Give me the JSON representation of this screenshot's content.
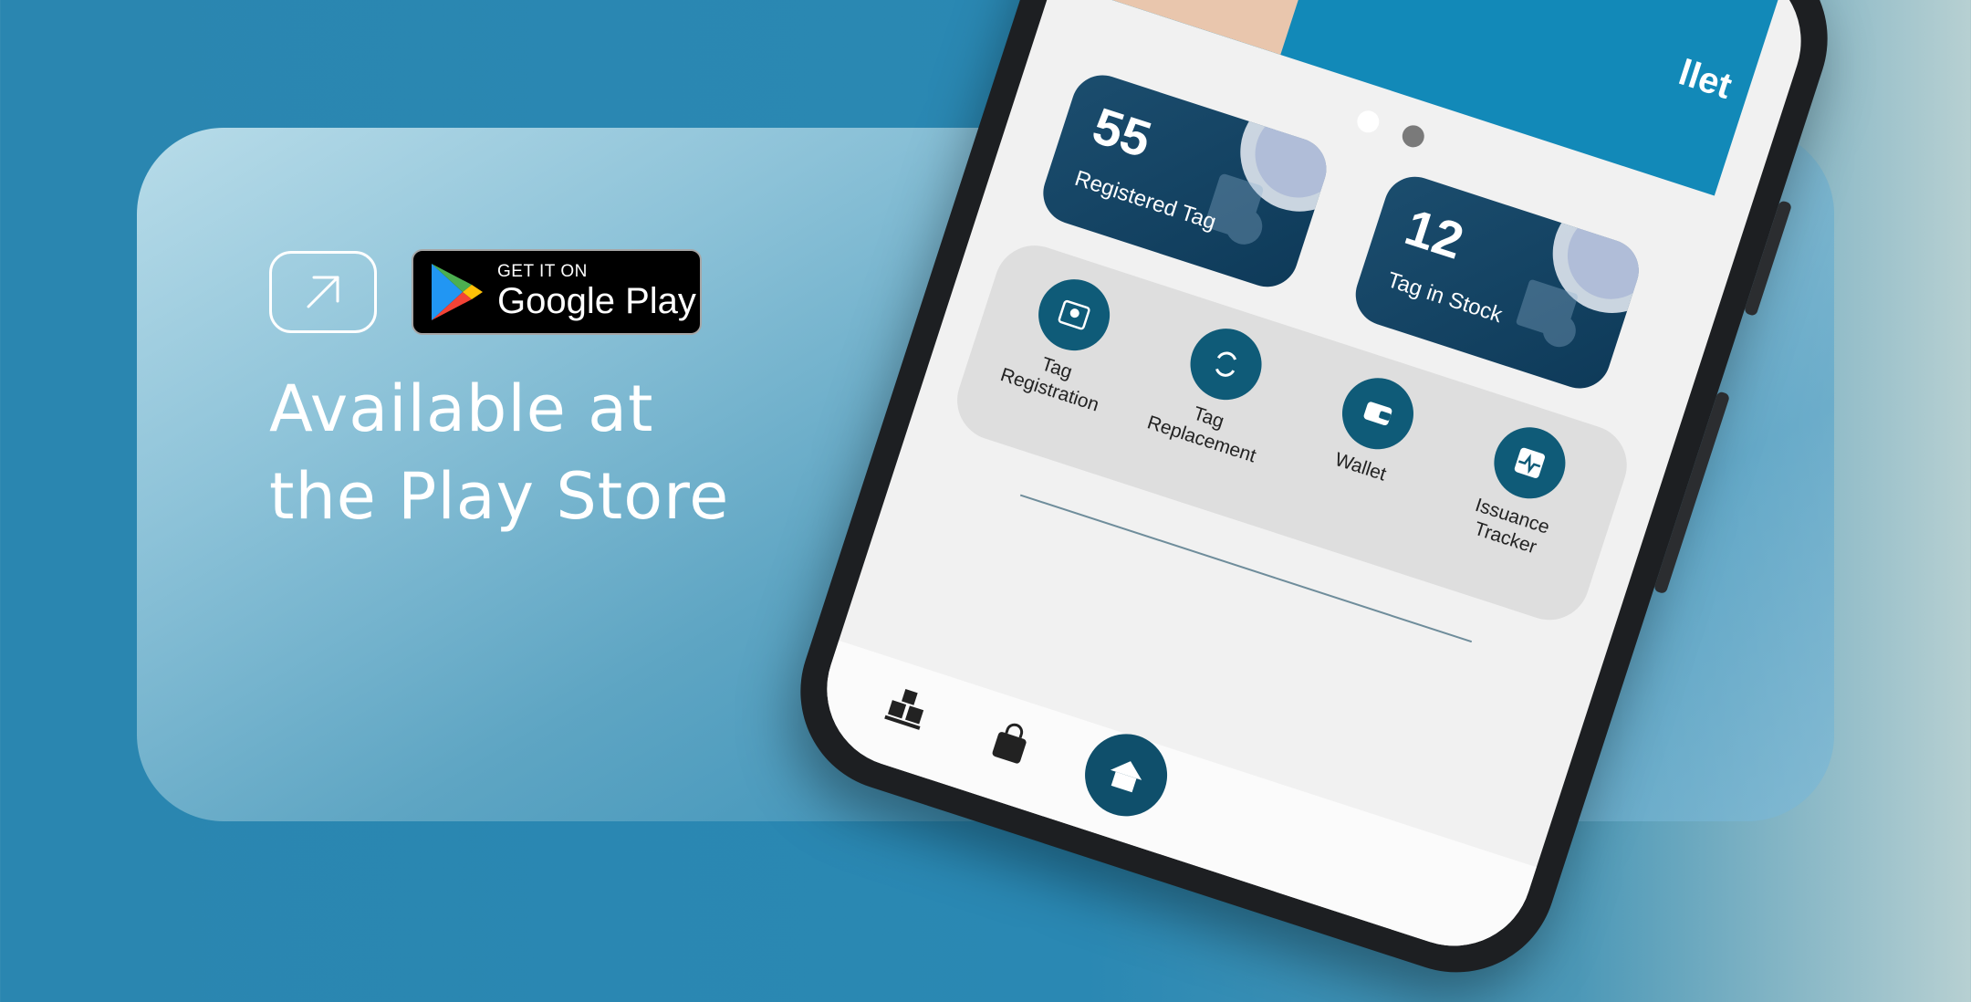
{
  "hero": {
    "headline_line1": "Available at",
    "headline_line2": "the Play Store"
  },
  "external_link": {
    "icon": "arrow-up-right-icon"
  },
  "play_badge": {
    "small_text": "GET IT ON",
    "big_text": "Google Play"
  },
  "phone": {
    "banner": {
      "word": "llet"
    },
    "carousel": {
      "dots": 2,
      "active_dot": 1
    },
    "stats": [
      {
        "value": "55",
        "label": "Registered Tag"
      },
      {
        "value": "12",
        "label": "Tag in Stock"
      }
    ],
    "actions": [
      {
        "label_line1": "Tag",
        "label_line2": "Registration",
        "icon": "id-card-icon"
      },
      {
        "label_line1": "Tag",
        "label_line2": "Replacement",
        "icon": "swap-icon"
      },
      {
        "label_line1": "Wallet",
        "label_line2": "",
        "icon": "wallet-icon"
      },
      {
        "label_line1": "Issuance",
        "label_line2": "Tracker",
        "icon": "pulse-icon"
      }
    ],
    "nav": [
      {
        "icon": "boxes-icon"
      },
      {
        "icon": "shopping-bag-icon"
      },
      {
        "icon": "home-icon"
      }
    ]
  },
  "colors": {
    "background": "#2a86b0",
    "accent": "#0f5b78",
    "card": "#0e3a59"
  }
}
